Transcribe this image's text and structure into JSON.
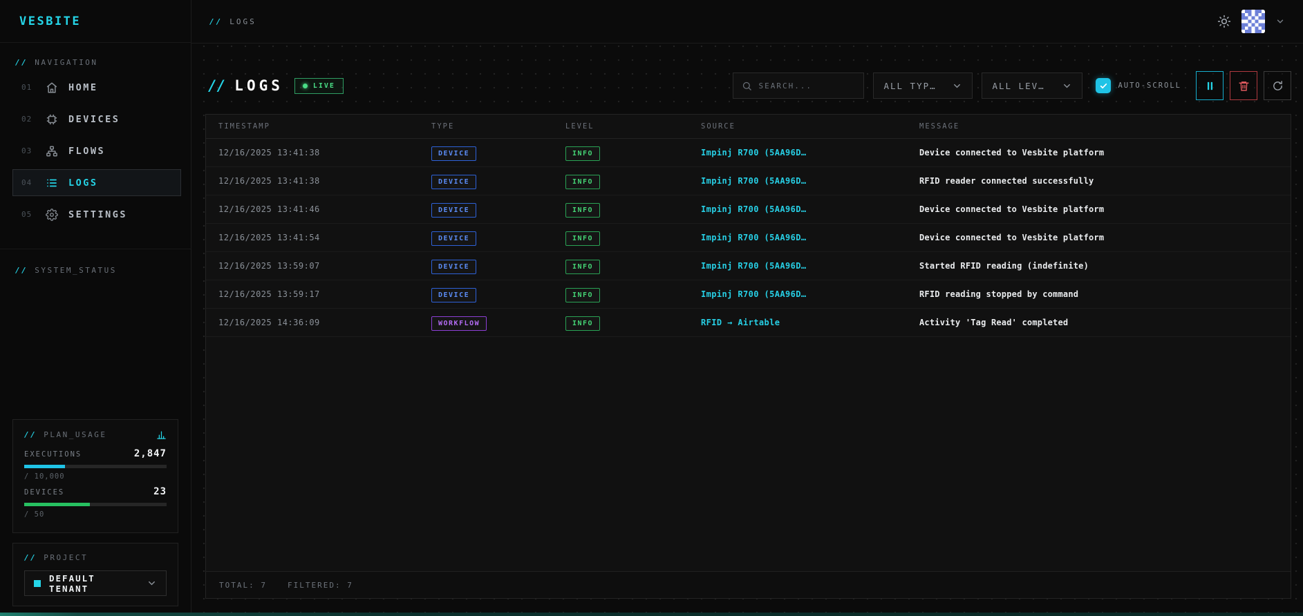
{
  "brand": {
    "name": "VESBITE"
  },
  "topbar": {
    "breadcrumb_prefix": "//",
    "breadcrumb": "LOGS"
  },
  "sidebar": {
    "nav_prefix": "//",
    "nav_label": "NAVIGATION",
    "items": [
      {
        "num": "01",
        "label": "HOME"
      },
      {
        "num": "02",
        "label": "DEVICES"
      },
      {
        "num": "03",
        "label": "FLOWS"
      },
      {
        "num": "04",
        "label": "LOGS"
      },
      {
        "num": "05",
        "label": "SETTINGS"
      }
    ],
    "system_status_prefix": "//",
    "system_status_label": "SYSTEM_STATUS",
    "plan_usage": {
      "prefix": "//",
      "label": "PLAN_USAGE",
      "metrics": [
        {
          "name": "EXECUTIONS",
          "value": "2,847",
          "limit": "/ 10,000",
          "percent": 28.5,
          "color": "#1fc3e6"
        },
        {
          "name": "DEVICES",
          "value": "23",
          "limit": "/ 50",
          "percent": 46,
          "color": "#27c061"
        }
      ]
    },
    "project": {
      "prefix": "//",
      "label": "PROJECT",
      "selected": "DEFAULT TENANT"
    }
  },
  "toolbar": {
    "title_prefix": "//",
    "title": "LOGS",
    "live_label": "LIVE",
    "search_placeholder": "SEARCH...",
    "type_filter_value": "ALL TYP…",
    "level_filter_value": "ALL LEV…",
    "autoscroll_label": "AUTO-SCROLL",
    "autoscroll_checked": true
  },
  "table": {
    "columns": [
      "TIMESTAMP",
      "TYPE",
      "LEVEL",
      "SOURCE",
      "MESSAGE"
    ],
    "rows": [
      {
        "timestamp": "12/16/2025 13:41:38",
        "type": "DEVICE",
        "level": "INFO",
        "source": "Impinj R700 (5AA96D…",
        "message": "Device connected to Vesbite platform"
      },
      {
        "timestamp": "12/16/2025 13:41:38",
        "type": "DEVICE",
        "level": "INFO",
        "source": "Impinj R700 (5AA96D…",
        "message": "RFID reader connected successfully"
      },
      {
        "timestamp": "12/16/2025 13:41:46",
        "type": "DEVICE",
        "level": "INFO",
        "source": "Impinj R700 (5AA96D…",
        "message": "Device connected to Vesbite platform"
      },
      {
        "timestamp": "12/16/2025 13:41:54",
        "type": "DEVICE",
        "level": "INFO",
        "source": "Impinj R700 (5AA96D…",
        "message": "Device connected to Vesbite platform"
      },
      {
        "timestamp": "12/16/2025 13:59:07",
        "type": "DEVICE",
        "level": "INFO",
        "source": "Impinj R700 (5AA96D…",
        "message": "Started RFID reading (indefinite)"
      },
      {
        "timestamp": "12/16/2025 13:59:17",
        "type": "DEVICE",
        "level": "INFO",
        "source": "Impinj R700 (5AA96D…",
        "message": "RFID reading stopped by command"
      },
      {
        "timestamp": "12/16/2025 14:36:09",
        "type": "WORKFLOW",
        "level": "INFO",
        "source": "RFID → Airtable",
        "message": "Activity 'Tag Read' completed"
      }
    ],
    "footer": {
      "total_label": "TOTAL:",
      "total_value": "7",
      "filtered_label": "FILTERED:",
      "filtered_value": "7"
    }
  },
  "colors": {
    "accent_cyan": "#25d5e8",
    "green": "#45d475",
    "blue": "#5b8cf5",
    "purple": "#b26bf2",
    "red": "#e05a5f",
    "background": "#0b0b0b"
  }
}
